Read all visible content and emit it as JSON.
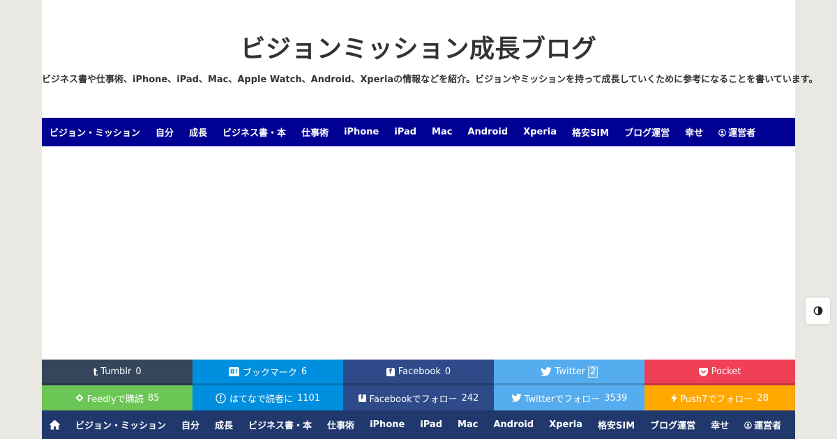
{
  "header": {
    "title": "ビジョンミッション成長ブログ",
    "description": "ビジネス書や仕事術、iPhone、iPad、Mac、Apple Watch、Android、Xperiaの情報などを紹介。ビジョンやミッションを持って成長していくために参考になることを書いています。"
  },
  "nav": {
    "items": [
      "ビジョン・ミッション",
      "自分",
      "成長",
      "ビジネス書・本",
      "仕事術",
      "iPhone",
      "iPad",
      "Mac",
      "Android",
      "Xperia",
      "格安SIM",
      "ブログ運営",
      "幸せ",
      "運営者"
    ]
  },
  "share": {
    "tumblr": {
      "label": "Tumblr",
      "count": "0",
      "color": "#35465c"
    },
    "hatena": {
      "label": "ブックマーク",
      "count": "6",
      "color": "#008fde"
    },
    "facebook": {
      "label": "Facebook",
      "count": "0",
      "color": "#2e4a88"
    },
    "twitter": {
      "label": "Twitter",
      "count": "2",
      "color": "#55acee"
    },
    "pocket": {
      "label": "Pocket",
      "color": "#ef4056"
    }
  },
  "follow": {
    "feedly": {
      "label": "Feedlyで購読",
      "count": "85",
      "color": "#6cc655"
    },
    "hatena": {
      "label": "はてなで読者に",
      "count": "1101",
      "color": "#008fde"
    },
    "facebook": {
      "label": "Facebookでフォロー",
      "count": "242",
      "color": "#2e4a88"
    },
    "twitter": {
      "label": "Twitterでフォロー",
      "count": "3539",
      "color": "#55acee"
    },
    "push7": {
      "label": "Push7でフォロー",
      "count": "28",
      "color": "#ffa800"
    }
  },
  "footer_nav": {
    "items": [
      "ビジョン・ミッション",
      "自分",
      "成長",
      "ビジネス書・本",
      "仕事術",
      "iPhone",
      "iPad",
      "Mac",
      "Android",
      "Xperia",
      "格安SIM",
      "ブログ運営",
      "幸せ",
      "運営者"
    ]
  },
  "colors": {
    "nav_bg": "#000093",
    "footer_nav_bg": "#20386c",
    "page_bg": "#e9e8e3"
  }
}
